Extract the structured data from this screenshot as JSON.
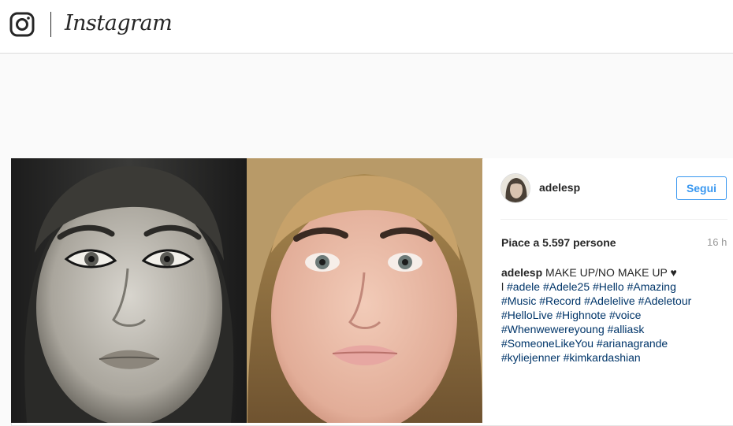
{
  "header": {
    "brand": "Instagram"
  },
  "post": {
    "username": "adelesp",
    "follow_label": "Segui",
    "likes": "Piace a 5.597 persone",
    "time": "16 h",
    "caption": {
      "author": "adelesp",
      "text": "MAKE UP/NO MAKE UP ♥",
      "prefix": "l",
      "hashtags": [
        "#adele",
        "#Adele25",
        "#Hello",
        "#Amazing",
        "#Music",
        "#Record",
        "#Adelelive",
        "#Adeletour",
        "#HelloLive",
        "#Highnote",
        "#voice",
        "#Whenwewereyoung",
        "#alliask",
        "#SomeoneLikeYou",
        "#arianagrande",
        "#kyliejenner",
        "#kimkardashian"
      ]
    }
  },
  "colors": {
    "link": "#003569",
    "follow": "#3897f0",
    "muted": "#999999"
  }
}
